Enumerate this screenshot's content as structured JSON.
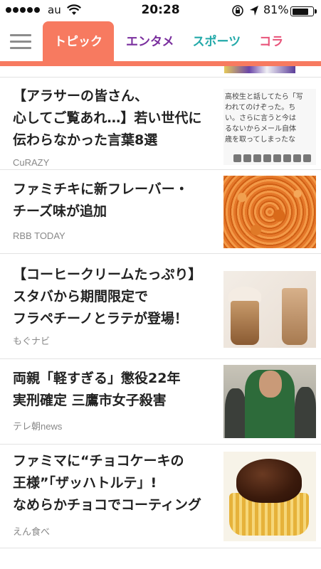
{
  "status_bar": {
    "carrier": "au",
    "time": "20:28",
    "battery": "81%",
    "battery_level": 0.81,
    "icons": [
      "signal-dots",
      "wifi-icon",
      "rotation-lock-icon",
      "location-arrow-icon",
      "battery-icon"
    ]
  },
  "tabs": [
    {
      "label": "トピック",
      "color": "#ffffff",
      "active": true
    },
    {
      "label": "エンタメ",
      "color": "#7a2f9e",
      "active": false
    },
    {
      "label": "スポーツ",
      "color": "#23a9a9",
      "active": false
    },
    {
      "label": "コラ",
      "color": "#e8547a",
      "active": false
    }
  ],
  "colors": {
    "accent": "#f77a60"
  },
  "articles": [
    {
      "title": "【アラサーの皆さん、心してご覧あれ…】若い世代に伝わらなかった言葉8選",
      "title_lines": [
        "【アラサーの皆さん、",
        "心してご覧あれ…】若い世代に",
        "伝わらなかった言葉8選"
      ],
      "source": "CuRAZY",
      "thumb_text": [
        "高校生と話してたら「写",
        "われてのけぞった。ち",
        "い。さらに言うと今は",
        "るないからメール自体",
        "歳を取ってしまったな"
      ]
    },
    {
      "title": "ファミチキに新フレーバー・チーズ味が追加",
      "title_lines": [
        "ファミチキに新フレーバー・",
        "チーズ味が追加"
      ],
      "source": "RBB TODAY"
    },
    {
      "title": "【コーヒークリームたっぷり】スタバから期間限定でフラペチーノとラテが登場！",
      "title_lines": [
        "【コーヒークリームたっぷり】",
        "スタバから期間限定で",
        "フラペチーノとラテが登場！"
      ],
      "source": "もぐナビ"
    },
    {
      "title": "両親「軽すぎる」懲役22年実刑確定 三鷹市女子殺害",
      "title_lines": [
        "両親「軽すぎる」懲役22年",
        "実刑確定 三鷹市女子殺害"
      ],
      "source": "テレ朝news"
    },
    {
      "title": "ファミマに“チョコケーキの王様”「ザッハトルテ」！なめらかチョコでコーティング",
      "title_lines": [
        "ファミマに“チョコケーキの",
        "王様”「ザッハトルテ」!",
        "なめらかチョコでコーティング"
      ],
      "source": "えん食べ"
    }
  ]
}
